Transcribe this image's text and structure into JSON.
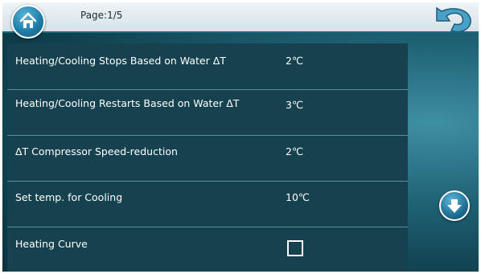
{
  "header": {
    "page_label": "Page:1/5",
    "home_icon": "home-icon",
    "back_icon": "back-arrow-icon"
  },
  "settings": [
    {
      "label": "Heating/Cooling Stops Based on Water ΔT",
      "value": "2℃"
    },
    {
      "label": "Heating/Cooling Restarts Based on Water ΔT",
      "value": "3℃"
    },
    {
      "label": "ΔT Compressor Speed-reduction",
      "value": "2℃"
    },
    {
      "label": "Set temp. for Cooling",
      "value": "10℃"
    },
    {
      "label": "Heating Curve",
      "checked": false
    }
  ],
  "nav": {
    "down_icon": "arrow-down-icon"
  },
  "colors": {
    "panel": "#16424f",
    "accent": "#1f7fa9",
    "text": "#ffffff"
  }
}
